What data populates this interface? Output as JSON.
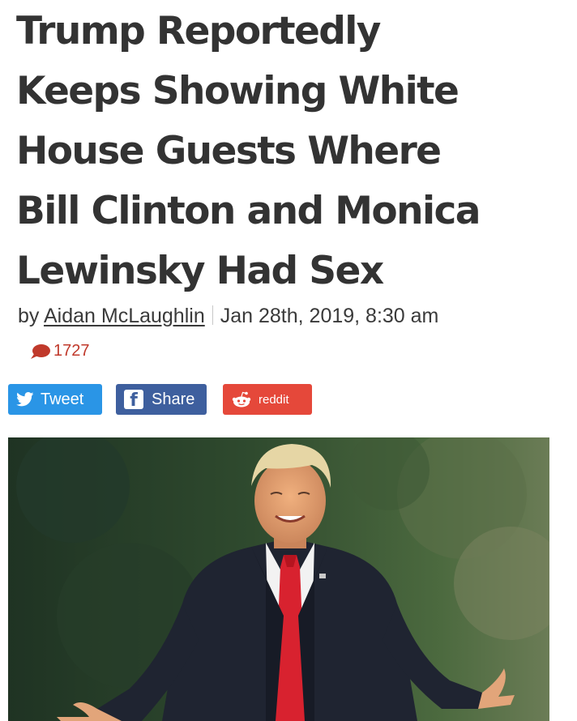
{
  "article": {
    "headline_lines": [
      "Trump Reportedly",
      "Keeps Showing White",
      "House Guests Where",
      "Bill Clinton and Monica",
      "Lewinsky Had Sex"
    ],
    "byline_prefix": "by",
    "author": "Aidan McLaughlin",
    "date": "Jan 28th, 2019, 8:30 am",
    "comment_count": "1727"
  },
  "share": {
    "tweet_label": "Tweet",
    "share_label": "Share",
    "reddit_label": "reddit"
  },
  "colors": {
    "tweet": "#2a95e6",
    "facebook": "#3e5f9e",
    "reddit": "#e5483a",
    "comment": "#c0392b"
  },
  "icons": {
    "comment": "comment-bubble-icon",
    "twitter": "twitter-bird-icon",
    "facebook": "facebook-f-icon",
    "reddit": "reddit-alien-icon"
  },
  "image": {
    "subject": "Man in dark suit with red tie smiling, arms spread, outdoors with trees behind"
  }
}
